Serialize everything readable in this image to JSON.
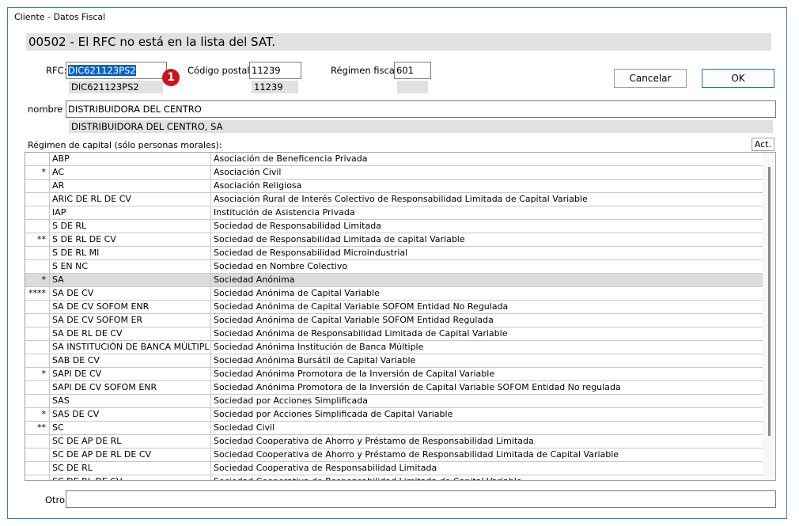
{
  "window": {
    "title": "Cliente - Datos Fiscal"
  },
  "message": "00502 - El RFC no está en la lista del SAT.",
  "rfc": {
    "label": "RFC:",
    "value": "DIC621123PS2",
    "reference": "DIC621123PS2",
    "badge": "1"
  },
  "postal": {
    "label": "Código postal:",
    "value": "11239",
    "reference": "11239"
  },
  "regimen": {
    "label": "Régimen fiscal:",
    "value": "601",
    "reference": ""
  },
  "buttons": {
    "cancel": "Cancelar",
    "ok": "OK",
    "act": "Act."
  },
  "nombre": {
    "label": "nombre",
    "value": "DISTRIBUIDORA DEL CENTRO",
    "reference": "DISTRIBUIDORA DEL CENTRO, SA"
  },
  "capital": {
    "label": "Régimen de capital (sólo personas morales):"
  },
  "rows": [
    {
      "mark": "",
      "code": "ABP",
      "desc": "Asociación de Beneficencia Privada"
    },
    {
      "mark": "*",
      "code": "AC",
      "desc": "Asociación Civil"
    },
    {
      "mark": "",
      "code": "AR",
      "desc": "Asociación Religiosa"
    },
    {
      "mark": "",
      "code": "ARIC DE RL DE CV",
      "desc": "Asociación Rural de Interés Colectivo de Responsabilidad Limitada de Capital Variable"
    },
    {
      "mark": "",
      "code": "IAP",
      "desc": "Institución de Asistencia Privada"
    },
    {
      "mark": "",
      "code": "S DE RL",
      "desc": "Sociedad de Responsabilidad Limitada"
    },
    {
      "mark": "**",
      "code": "S DE RL DE CV",
      "desc": "Sociedad de Responsabilidad Limitada de capital Variable"
    },
    {
      "mark": "",
      "code": "S DE RL MI",
      "desc": "Sociedad de Responsabilidad Microindustrial"
    },
    {
      "mark": "",
      "code": "S EN NC",
      "desc": "Sociedad en Nombre Colectivo"
    },
    {
      "mark": "*",
      "code": "SA",
      "desc": "Sociedad Anónima",
      "highlight": true
    },
    {
      "mark": "****",
      "code": "SA DE CV",
      "desc": "Sociedad Anónima de Capital Variable"
    },
    {
      "mark": "",
      "code": "SA DE CV SOFOM ENR",
      "desc": "Sociedad Anónima de Capital Variable SOFOM Entidad No Regulada"
    },
    {
      "mark": "",
      "code": "SA DE CV SOFOM ER",
      "desc": "Sociedad Anónima de Capital Variable SOFOM Entidad Regulada"
    },
    {
      "mark": "",
      "code": "SA DE RL DE CV",
      "desc": "Sociedad Anónima de Responsabilidad Limitada de Capital Variable"
    },
    {
      "mark": "",
      "code": "SA INSTITUCIÓN DE BANCA MÚLTIPL",
      "desc": "Sociedad Anónima Institución de Banca Múltiple"
    },
    {
      "mark": "",
      "code": "SAB DE CV",
      "desc": "Sociedad Anónima Bursátil de Capital Variable"
    },
    {
      "mark": "*",
      "code": "SAPI DE CV",
      "desc": "Sociedad Anónima Promotora de la Inversión de Capital Variable"
    },
    {
      "mark": "",
      "code": "SAPI DE CV SOFOM ENR",
      "desc": "Sociedad Anónima Promotora de la Inversión de Capital Variable SOFOM Entidad No regulada"
    },
    {
      "mark": "",
      "code": "SAS",
      "desc": "Sociedad por Acciones Simplificada"
    },
    {
      "mark": "*",
      "code": "SAS DE CV",
      "desc": "Sociedad por Acciones Simplificada de Capital Variable"
    },
    {
      "mark": "**",
      "code": "SC",
      "desc": "Sociedad Civil"
    },
    {
      "mark": "",
      "code": "SC DE AP DE RL",
      "desc": "Sociedad Cooperativa de Ahorro y Préstamo de Responsabilidad Limitada"
    },
    {
      "mark": "",
      "code": "SC DE AP DE RL DE CV",
      "desc": "Sociedad Cooperativa de Ahorro y Préstamo de Responsabilidad Limitada de Capital Variable"
    },
    {
      "mark": "",
      "code": "SC DE RL",
      "desc": "Sociedad Cooperativa de Responsabilidad Limitada"
    },
    {
      "mark": "",
      "code": "SC DE RL DE CV",
      "desc": "Sociedad Cooperativa de Responsabilidad Limitada de Capital Variable"
    }
  ],
  "otro": {
    "label": "Otro:",
    "value": ""
  }
}
